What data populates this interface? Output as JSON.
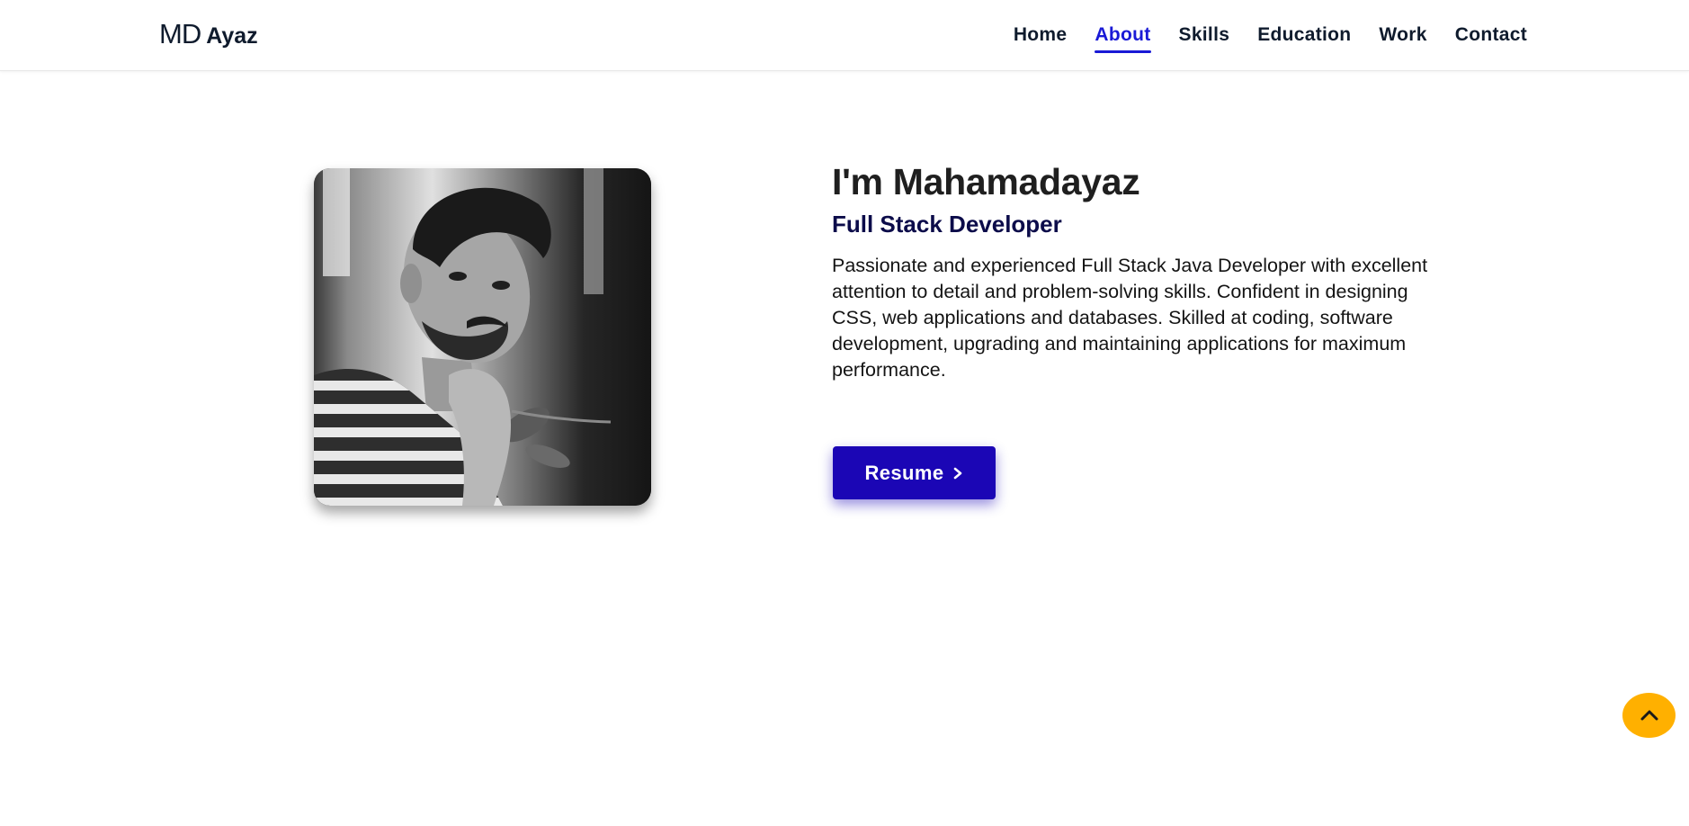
{
  "header": {
    "logo": {
      "prefix": "MD",
      "name": "Ayaz"
    },
    "nav": [
      {
        "label": "Home"
      },
      {
        "label": "About",
        "active": true
      },
      {
        "label": "Skills"
      },
      {
        "label": "Education"
      },
      {
        "label": "Work"
      },
      {
        "label": "Contact"
      }
    ]
  },
  "about": {
    "greeting": "I'm Mahamadayaz",
    "role": "Full Stack Developer",
    "bio": "Passionate and experienced Full Stack Java Developer with excellent attention to detail and problem-solving skills. Confident in designing CSS, web applications and databases. Skilled at coding, software development, upgrading and maintaining applications for maximum performance.",
    "resume_label": "Resume",
    "resume_icon": "chevron-right-icon",
    "photo_alt": "profile-photo"
  },
  "scroll_top": {
    "icon": "chevron-up-icon"
  },
  "colors": {
    "accent": "#1a1ad6",
    "button": "#1b06b5",
    "scroll_top": "#ffb000",
    "role_text": "#0c0c4a"
  }
}
